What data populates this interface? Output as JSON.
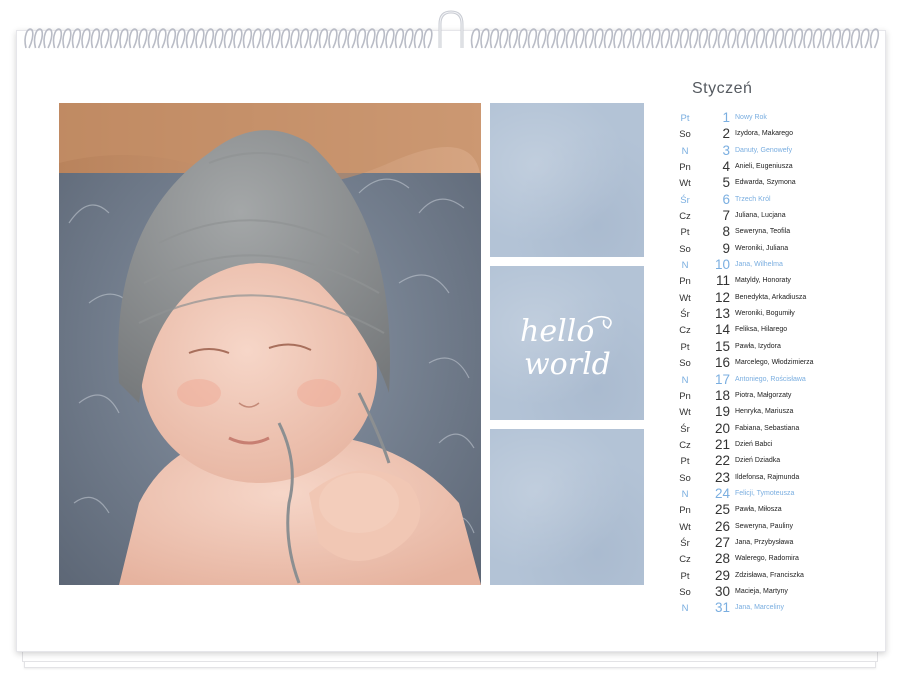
{
  "calendar": {
    "month": "Styczeń",
    "days": [
      {
        "dow": "Pt",
        "day": "1",
        "names": "Nowy Rok",
        "holiday": true
      },
      {
        "dow": "So",
        "day": "2",
        "names": "Izydora, Makarego",
        "holiday": false
      },
      {
        "dow": "N",
        "day": "3",
        "names": "Danuty, Genowefy",
        "holiday": true
      },
      {
        "dow": "Pn",
        "day": "4",
        "names": "Anieli, Eugeniusza",
        "holiday": false
      },
      {
        "dow": "Wt",
        "day": "5",
        "names": "Edwarda, Szymona",
        "holiday": false
      },
      {
        "dow": "Śr",
        "day": "6",
        "names": "Trzech Król",
        "holiday": true
      },
      {
        "dow": "Cz",
        "day": "7",
        "names": "Juliana, Lucjana",
        "holiday": false
      },
      {
        "dow": "Pt",
        "day": "8",
        "names": "Seweryna, Teofila",
        "holiday": false
      },
      {
        "dow": "So",
        "day": "9",
        "names": "Weroniki, Juliana",
        "holiday": false
      },
      {
        "dow": "N",
        "day": "10",
        "names": "Jana, Wilhelma",
        "holiday": true
      },
      {
        "dow": "Pn",
        "day": "11",
        "names": "Matyldy, Honoraty",
        "holiday": false
      },
      {
        "dow": "Wt",
        "day": "12",
        "names": "Benedykta, Arkadiusza",
        "holiday": false
      },
      {
        "dow": "Śr",
        "day": "13",
        "names": "Weroniki, Bogumiły",
        "holiday": false
      },
      {
        "dow": "Cz",
        "day": "14",
        "names": "Feliksa, Hilarego",
        "holiday": false
      },
      {
        "dow": "Pt",
        "day": "15",
        "names": "Pawła, Izydora",
        "holiday": false
      },
      {
        "dow": "So",
        "day": "16",
        "names": "Marcelego, Włodzimierza",
        "holiday": false
      },
      {
        "dow": "N",
        "day": "17",
        "names": "Antoniego, Rościsława",
        "holiday": true
      },
      {
        "dow": "Pn",
        "day": "18",
        "names": "Piotra, Małgorzaty",
        "holiday": false
      },
      {
        "dow": "Wt",
        "day": "19",
        "names": "Henryka, Mariusza",
        "holiday": false
      },
      {
        "dow": "Śr",
        "day": "20",
        "names": "Fabiana, Sebastiana",
        "holiday": false
      },
      {
        "dow": "Cz",
        "day": "21",
        "names": "Dzień Babci",
        "holiday": false
      },
      {
        "dow": "Pt",
        "day": "22",
        "names": "Dzień Dziadka",
        "holiday": false
      },
      {
        "dow": "So",
        "day": "23",
        "names": "Ildefonsa, Rajmunda",
        "holiday": false
      },
      {
        "dow": "N",
        "day": "24",
        "names": "Felicji, Tymoteusza",
        "holiday": true
      },
      {
        "dow": "Pn",
        "day": "25",
        "names": "Pawła, Miłosza",
        "holiday": false
      },
      {
        "dow": "Wt",
        "day": "26",
        "names": "Seweryna, Pauliny",
        "holiday": false
      },
      {
        "dow": "Śr",
        "day": "27",
        "names": "Jana, Przybysława",
        "holiday": false
      },
      {
        "dow": "Cz",
        "day": "28",
        "names": "Walerego, Radomira",
        "holiday": false
      },
      {
        "dow": "Pt",
        "day": "29",
        "names": "Zdzisława, Franciszka",
        "holiday": false
      },
      {
        "dow": "So",
        "day": "30",
        "names": "Macieja, Martyny",
        "holiday": false
      },
      {
        "dow": "N",
        "day": "31",
        "names": "Jana, Marceliny",
        "holiday": true
      }
    ]
  },
  "tiles": {
    "text_line1": "hello",
    "text_line2": "world"
  },
  "colors": {
    "tile": "#b3c3d6",
    "holiday": "#7aaee0",
    "text": "#222222"
  }
}
